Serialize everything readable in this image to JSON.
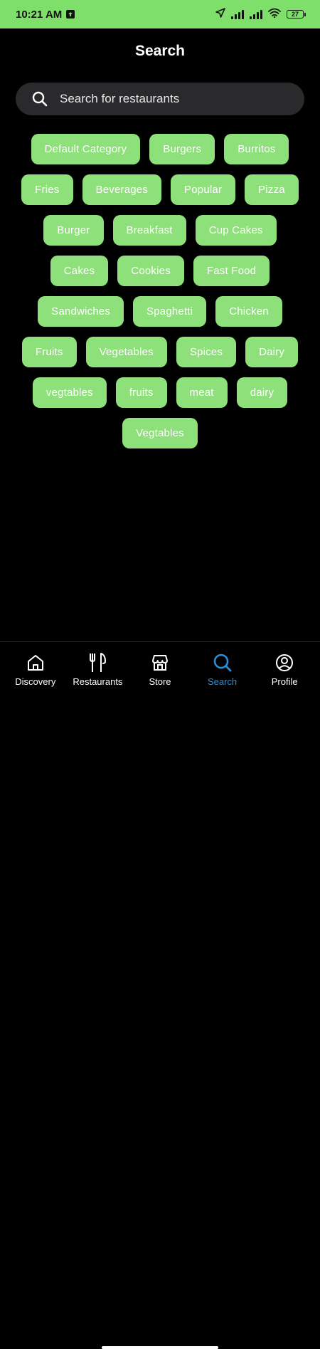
{
  "status_bar": {
    "time": "10:21 AM",
    "battery": "27"
  },
  "header": {
    "title": "Search"
  },
  "search": {
    "placeholder": "Search for restaurants"
  },
  "categories": {
    "rows": [
      [
        "Default Category",
        "Burgers",
        "Burritos"
      ],
      [
        "Fries",
        "Beverages",
        "Popular",
        "Pizza"
      ],
      [
        "Burger",
        "Breakfast",
        "Cup Cakes"
      ],
      [
        "Cakes",
        "Cookies",
        "Fast Food"
      ],
      [
        "Sandwiches",
        "Spaghetti",
        "Chicken"
      ],
      [
        "Fruits",
        "Vegetables",
        "Spices",
        "Dairy"
      ],
      [
        "vegtables",
        "fruits",
        "meat",
        "dairy"
      ],
      [
        "Vegtables"
      ]
    ]
  },
  "nav": {
    "items": [
      {
        "label": "Discovery",
        "icon": "home-icon"
      },
      {
        "label": "Restaurants",
        "icon": "utensils-icon"
      },
      {
        "label": "Store",
        "icon": "store-icon"
      },
      {
        "label": "Search",
        "icon": "search-icon"
      },
      {
        "label": "Profile",
        "icon": "profile-icon"
      }
    ],
    "active": "Search"
  },
  "colors": {
    "status_bar_bg": "#7ee06a",
    "chip_bg": "#8ee07a",
    "active_nav": "#2a8fd8",
    "search_bg": "#2a2a2c"
  }
}
